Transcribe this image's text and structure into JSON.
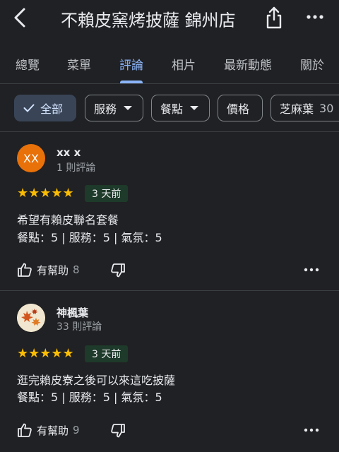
{
  "header": {
    "title": "不賴皮窯烤披薩 錦州店",
    "back_icon": "back-arrow-icon",
    "share_icon": "share-icon",
    "more_icon": "more-horizontal-icon"
  },
  "tabs": [
    {
      "label": "總覽",
      "active": false
    },
    {
      "label": "菜單",
      "active": false
    },
    {
      "label": "評論",
      "active": true
    },
    {
      "label": "相片",
      "active": false
    },
    {
      "label": "最新動態",
      "active": false
    },
    {
      "label": "關於",
      "active": false
    }
  ],
  "filters": {
    "all": "全部",
    "service": "服務",
    "meal": "餐點",
    "price": "價格",
    "topic": "芝麻葉",
    "topic_count": "30"
  },
  "reviews": [
    {
      "avatar_initials": "XX",
      "name": "xx x",
      "review_count": "1 則評論",
      "stars": "★★★★★",
      "time": "3 天前",
      "text": "希望有賴皮聯名套餐",
      "ratings": "餐點：5 | 服務：5 | 氣氛：5",
      "helpful_label": "有幫助",
      "helpful_count": "8"
    },
    {
      "name": "神楓葉",
      "review_count": "33 則評論",
      "stars": "★★★★★",
      "time": "3 天前",
      "text": "逛完賴皮寮之後可以來這吃披薩",
      "ratings": "餐點：5 | 服務：5 | 氣氛：5",
      "helpful_label": "有幫助",
      "helpful_count": "9"
    }
  ],
  "colors": {
    "background": "#202124",
    "accent": "#8ab4f8",
    "star": "#fbbc04",
    "avatar_orange": "#e8710a",
    "badge_bg": "#1e3a2a"
  }
}
